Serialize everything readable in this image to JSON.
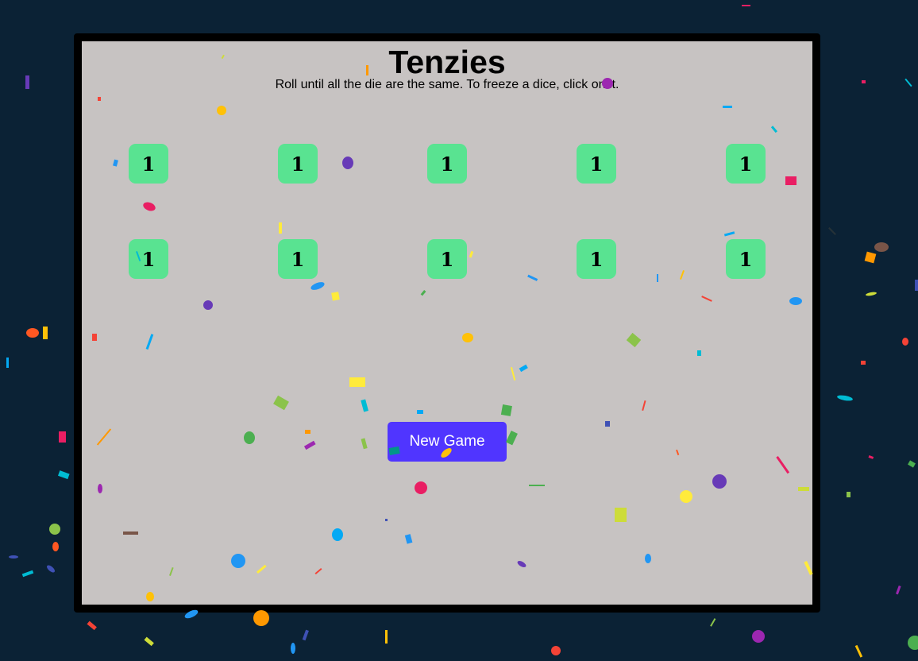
{
  "game": {
    "title": "Tenzies",
    "instructions": "Roll until all the die are the same. To freeze a dice, click on it.",
    "new_game_label": "New Game",
    "dice": [
      {
        "value": "1",
        "held": false
      },
      {
        "value": "1",
        "held": false
      },
      {
        "value": "1",
        "held": false
      },
      {
        "value": "1",
        "held": false
      },
      {
        "value": "1",
        "held": false
      },
      {
        "value": "1",
        "held": false
      },
      {
        "value": "1",
        "held": false
      },
      {
        "value": "1",
        "held": false
      },
      {
        "value": "1",
        "held": false
      },
      {
        "value": "1",
        "held": false
      }
    ],
    "won": true
  },
  "colors": {
    "page_background": "#0b2235",
    "board_background": "#c7c3c2",
    "board_border": "#000000",
    "die": "#59e391",
    "button": "#5035ff",
    "button_text": "#ffffff"
  }
}
